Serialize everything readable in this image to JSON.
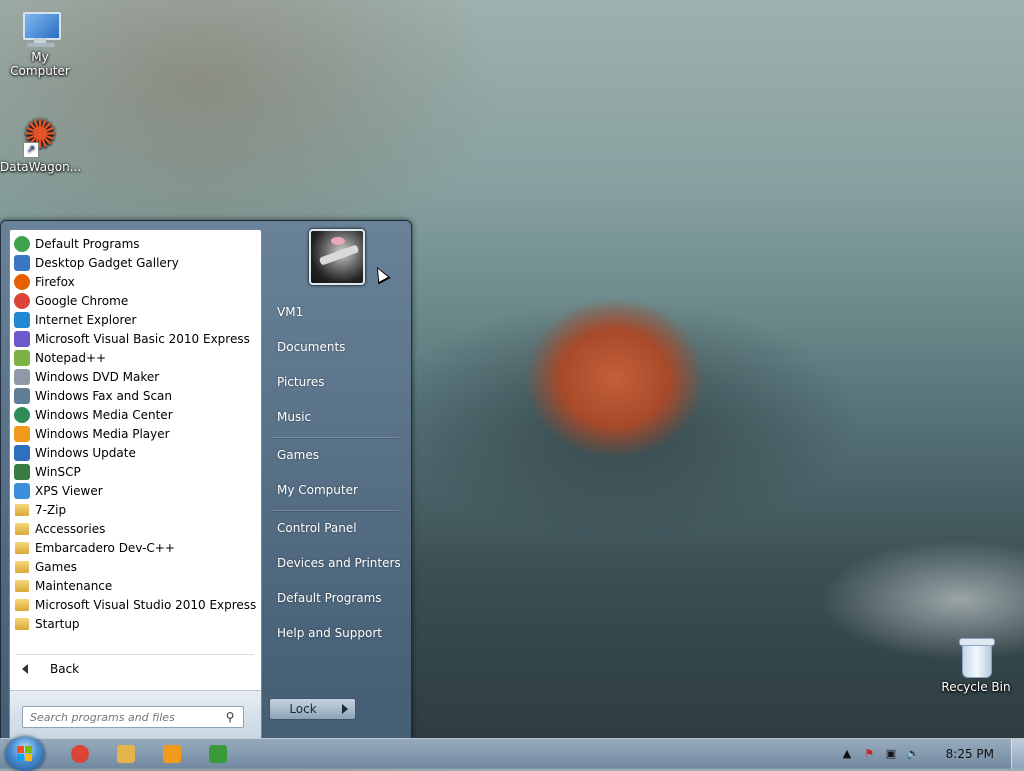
{
  "desktop": {
    "icons": [
      {
        "label": "My Computer",
        "icon": "my-computer-icon"
      },
      {
        "label": "DataWagon...",
        "icon": "datawagon-shortcut-icon"
      },
      {
        "label": "Recycle Bin",
        "icon": "recycle-bin-icon"
      }
    ]
  },
  "start_menu": {
    "programs": [
      {
        "label": "Default Programs",
        "icon": "default-programs-icon",
        "color": "#3fa34d"
      },
      {
        "label": "Desktop Gadget Gallery",
        "icon": "gadget-gallery-icon",
        "color": "#3b78c4"
      },
      {
        "label": "Firefox",
        "icon": "firefox-icon",
        "color": "#e66000"
      },
      {
        "label": "Google Chrome",
        "icon": "chrome-icon",
        "color": "#db4437"
      },
      {
        "label": "Internet Explorer",
        "icon": "internet-explorer-icon",
        "color": "#1e88d4"
      },
      {
        "label": "Microsoft Visual Basic 2010 Express",
        "icon": "visual-basic-icon",
        "color": "#6a5acd"
      },
      {
        "label": "Notepad++",
        "icon": "notepadpp-icon",
        "color": "#7cb342"
      },
      {
        "label": "Windows DVD Maker",
        "icon": "dvd-maker-icon",
        "color": "#8e9aa8"
      },
      {
        "label": "Windows Fax and Scan",
        "icon": "fax-scan-icon",
        "color": "#5f7d95"
      },
      {
        "label": "Windows Media Center",
        "icon": "media-center-icon",
        "color": "#2e8b57"
      },
      {
        "label": "Windows Media Player",
        "icon": "media-player-icon",
        "color": "#f29a1b"
      },
      {
        "label": "Windows Update",
        "icon": "windows-update-icon",
        "color": "#2f6fbf"
      },
      {
        "label": "WinSCP",
        "icon": "winscp-icon",
        "color": "#3a7d44"
      },
      {
        "label": "XPS Viewer",
        "icon": "xps-viewer-icon",
        "color": "#3b8edb"
      },
      {
        "label": "7-Zip",
        "icon": "folder-icon",
        "color": "#e3b44a"
      },
      {
        "label": "Accessories",
        "icon": "folder-icon",
        "color": "#e3b44a"
      },
      {
        "label": "Embarcadero Dev-C++",
        "icon": "folder-icon",
        "color": "#e3b44a"
      },
      {
        "label": "Games",
        "icon": "folder-icon",
        "color": "#e3b44a"
      },
      {
        "label": "Maintenance",
        "icon": "folder-icon",
        "color": "#e3b44a"
      },
      {
        "label": "Microsoft Visual Studio 2010 Express",
        "icon": "folder-icon",
        "color": "#e3b44a"
      },
      {
        "label": "Startup",
        "icon": "folder-icon",
        "color": "#e3b44a"
      }
    ],
    "back_label": "Back",
    "search_placeholder": "Search programs and files",
    "right_links": {
      "user": "VM1",
      "documents": "Documents",
      "pictures": "Pictures",
      "music": "Music",
      "games": "Games",
      "my_computer": "My Computer",
      "control_panel": "Control Panel",
      "devices_printers": "Devices and Printers",
      "default_programs": "Default Programs",
      "help_support": "Help and Support"
    },
    "lock_label": "Lock"
  },
  "taskbar": {
    "pinned": [
      {
        "icon": "chrome-icon",
        "color": "#db4437"
      },
      {
        "icon": "explorer-folder-icon",
        "color": "#e3b44a"
      },
      {
        "icon": "media-player-icon",
        "color": "#f29a1b"
      },
      {
        "icon": "csharp-express-icon",
        "color": "#3a9a3a"
      }
    ],
    "clock": "8:25 PM"
  }
}
